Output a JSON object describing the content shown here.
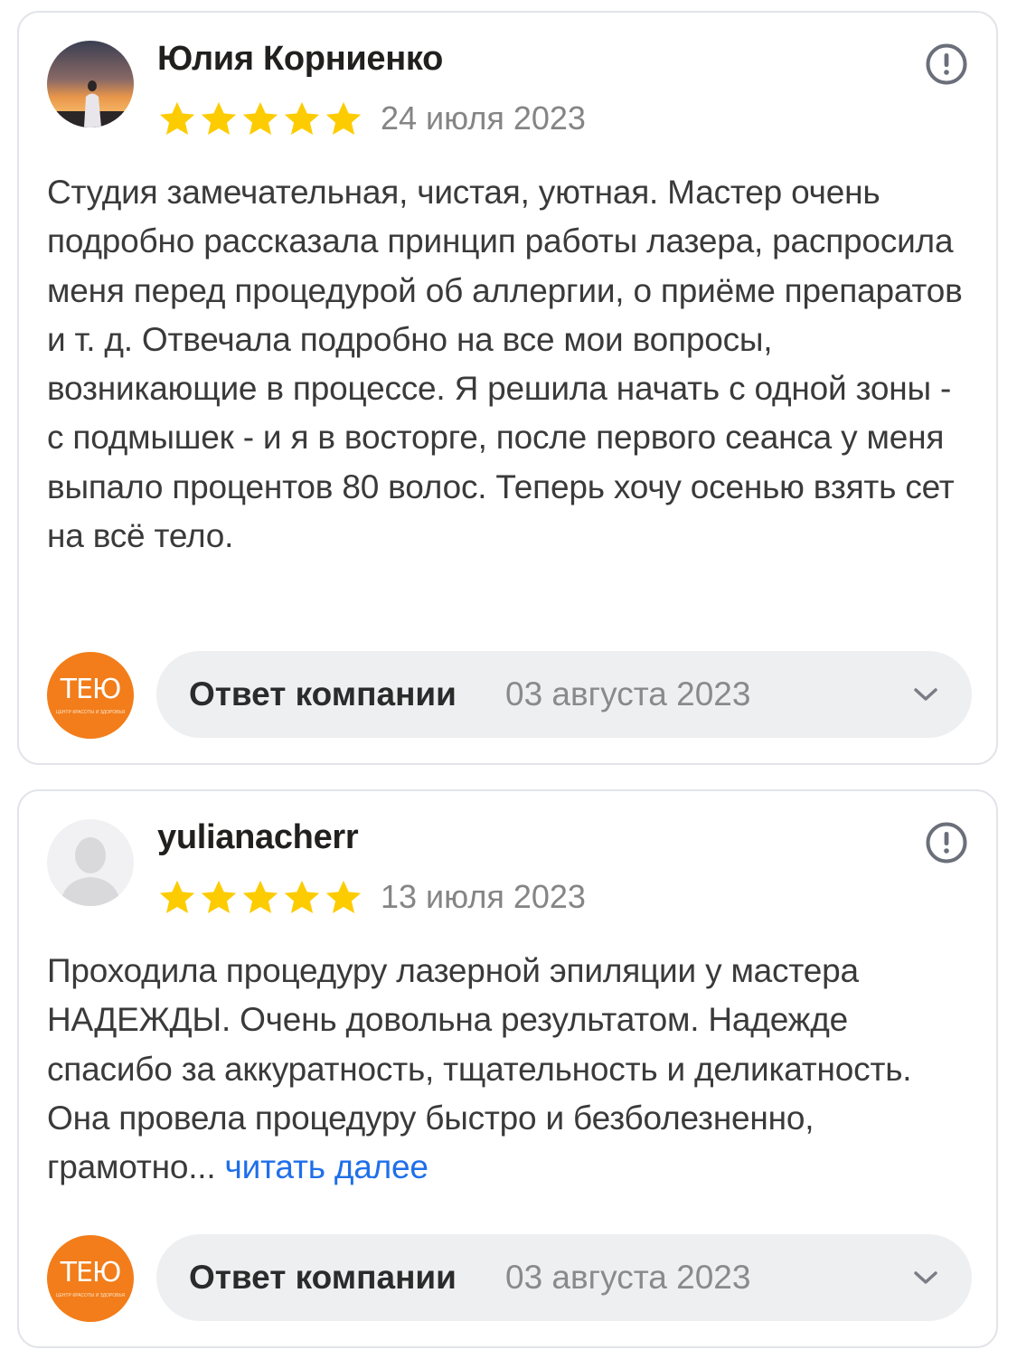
{
  "reviews": [
    {
      "author": "Юлия Корниенко",
      "rating": 5,
      "date": "24 июля 2023",
      "text": "Студия замечательная, чистая, уютная. Мастер очень подробно рассказала принцип работы лазера, распросила меня перед процедурой об аллергии, о приёме препаратов и т. д. Отвечала подробно на все мои вопросы, возникающие в процессе. Я решила начать с одной зоны - с подмышек - и я в восторге, после первого сеанса у меня выпало процентов 80 волос. Теперь хочу осенью взять сет на всё тело.",
      "avatar_icon": "user-photo-avatar",
      "report_icon": "exclamation-circle-icon",
      "company_logo": {
        "text": "ТЕЮ",
        "tagline": "ЦЕНТР КРАСОТЫ И ЗДОРОВЬЯ"
      },
      "reply": {
        "label": "Ответ компании",
        "date": "03 августа 2023",
        "icon": "chevron-down-icon"
      }
    },
    {
      "author": "yulianacherr",
      "rating": 5,
      "date": "13 июля 2023",
      "text": "Проходила процедуру лазерной эпиляции у мастера НАДЕЖДЫ. Очень довольна результатом. Надежде спасибо за аккуратность, тщательность и деликатность. Она провела процедуру быстро и безболезненно, грамотно...",
      "read_more": "читать далее",
      "avatar_icon": "default-user-avatar",
      "report_icon": "exclamation-circle-icon",
      "company_logo": {
        "text": "ТЕЮ",
        "tagline": "ЦЕНТР КРАСОТЫ И ЗДОРОВЬЯ"
      },
      "reply": {
        "label": "Ответ компании",
        "date": "03 августа 2023",
        "icon": "chevron-down-icon"
      }
    }
  ],
  "colors": {
    "star": "#fccc00",
    "link": "#1f6fea",
    "date": "#858585",
    "brand": "#f27d1a",
    "border": "#e2e4e9",
    "pill": "#eeeff1"
  }
}
